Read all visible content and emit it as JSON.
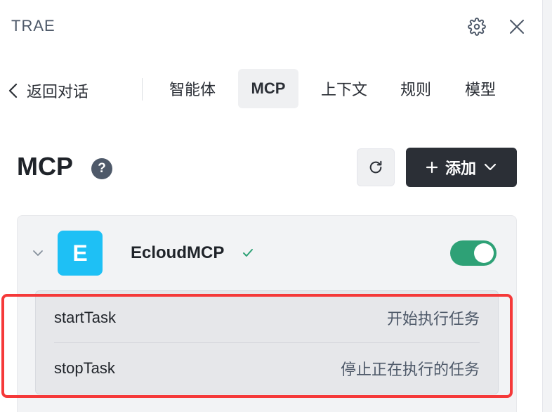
{
  "header": {
    "title": "TRAE"
  },
  "nav": {
    "back_label": "返回对话",
    "tabs": [
      {
        "label": "智能体",
        "active": false
      },
      {
        "label": "MCP",
        "active": true
      },
      {
        "label": "上下文",
        "active": false
      },
      {
        "label": "规则",
        "active": false
      },
      {
        "label": "模型",
        "active": false
      }
    ]
  },
  "page": {
    "title": "MCP",
    "help_glyph": "?",
    "add_label": "添加"
  },
  "server": {
    "logo_letter": "E",
    "name": "EcloudMCP",
    "enabled": true,
    "status": "connected",
    "tools": [
      {
        "name": "startTask",
        "description": "开始执行任务"
      },
      {
        "name": "stopTask",
        "description": "停止正在执行的任务"
      }
    ]
  },
  "colors": {
    "accent_dark": "#2b2f36",
    "toggle_on": "#2ea176",
    "logo_bg": "#1ec0f5",
    "highlight": "#f53939"
  }
}
